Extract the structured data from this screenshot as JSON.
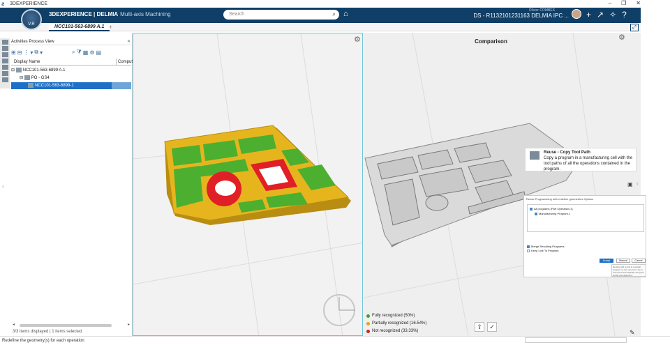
{
  "window": {
    "title": "3DEXPERIENCE"
  },
  "topbar": {
    "compass_label": "V.R",
    "brand_main": "3DEXPERIENCE | DELMIA",
    "brand_app": "Multi-axis Machining",
    "search_placeholder": "Search",
    "user": "Olivier COMBES",
    "context": "DS - R1132101231163 DELMIA IPC ..."
  },
  "tab": {
    "label": "NCC101-563-6899 A.1",
    "plus": "+"
  },
  "panel": {
    "title": "Activities Process View",
    "close": "✕",
    "col_display": "Display Name",
    "col_compute": "Compute",
    "tree": [
      {
        "label": "NCC101-563-6899 A.1"
      },
      {
        "label": "PO - GS4"
      },
      {
        "label": "NCC101-563-6899-1"
      }
    ],
    "status": "3/3 items displayed | 1 items selected"
  },
  "viewport2": {
    "title": "Comparison"
  },
  "legend": {
    "fully": "Fully recognized (50%)",
    "partially": "Partially recognized (16.54%)",
    "not": "Not recognized (33.33%)",
    "colors": {
      "fully": "#3ca32f",
      "partially": "#e2a21c",
      "not": "#d21f26"
    }
  },
  "callout": {
    "title": "Reuse - Copy Tool Path",
    "body": "Copy a program in a manufacturing cell with the tool paths of all the operations contained in the program."
  },
  "dialog": {
    "title": "Reuse Programming with redefine geometries Options",
    "opt1": "All programs (Part Operation.1)",
    "opt2": "Manufacturing Program.1",
    "opt3": "Merge Resulting Programs",
    "opt4": "Keep Link To Program",
    "btn_ok": "Accept Link",
    "btn_manual": "Manual",
    "btn_cancel": "Cancel",
    "tip": "Reusing will re-link to a partial program on the new part. Use to reconnect automatically using the similar part algorithm."
  },
  "statusbar": {
    "text": "Redefine the geometry(s) for each operation"
  }
}
